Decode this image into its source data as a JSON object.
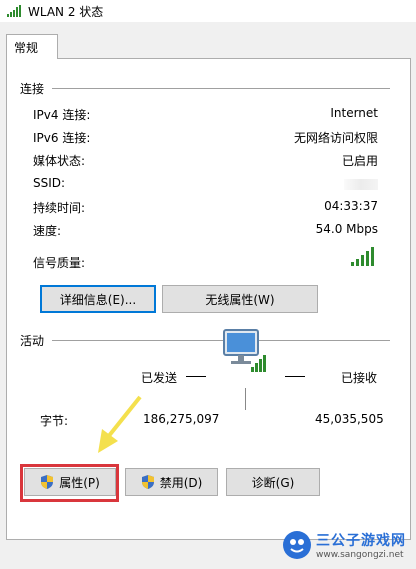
{
  "window": {
    "title": "WLAN 2 状态"
  },
  "tabs": [
    {
      "label": "常规"
    }
  ],
  "connection": {
    "section_title": "连接",
    "rows": [
      {
        "label": "IPv4 连接:",
        "value": "Internet"
      },
      {
        "label": "IPv6 连接:",
        "value": "无网络访问权限"
      },
      {
        "label": "媒体状态:",
        "value": "已启用"
      },
      {
        "label": "SSID:",
        "value": ""
      },
      {
        "label": "持续时间:",
        "value": "04:33:37"
      },
      {
        "label": "速度:",
        "value": "54.0 Mbps"
      },
      {
        "label": "信号质量:",
        "value": ""
      }
    ],
    "signal_bars": 5,
    "details_button": "详细信息(E)...",
    "wireless_props_button": "无线属性(W)"
  },
  "activity": {
    "section_title": "活动",
    "sent_label": "已发送",
    "received_label": "已接收",
    "bytes_label": "字节:",
    "bytes_sent": "186,275,097",
    "bytes_received": "45,035,505"
  },
  "buttons": {
    "properties": "属性(P)",
    "disable": "禁用(D)",
    "diagnose": "诊断(G)"
  },
  "watermark": {
    "name": "三公子游戏网",
    "url": "www.sangongzi.net"
  },
  "colors": {
    "accent": "#0078d7",
    "signal": "#2e8b2e",
    "highlight_box": "#d9363c",
    "arrow": "#f4e04d"
  }
}
